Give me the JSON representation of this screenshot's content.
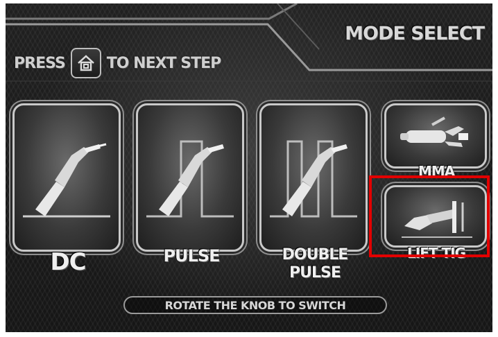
{
  "header": {
    "title": "MODE SELECT"
  },
  "instruction": {
    "press": "PRESS",
    "icon": "home-icon",
    "to_next": "TO NEXT STEP"
  },
  "modes": [
    {
      "label": "DC",
      "icon": "torch-icon"
    },
    {
      "label": "PULSE",
      "icon": "pulse-torch-icon"
    },
    {
      "label_line1": "DOUBLE",
      "label_line2": "PULSE",
      "icon": "double-pulse-torch-icon"
    },
    {
      "label": "MMA",
      "icon": "electrode-holder-icon"
    },
    {
      "label": "LIFT TIG",
      "icon": "lift-tig-torch-icon"
    }
  ],
  "selected": "LIFT TIG",
  "highlight_color": "#e30000",
  "footer": {
    "hint": "ROTATE THE KNOB TO SWITCH"
  }
}
